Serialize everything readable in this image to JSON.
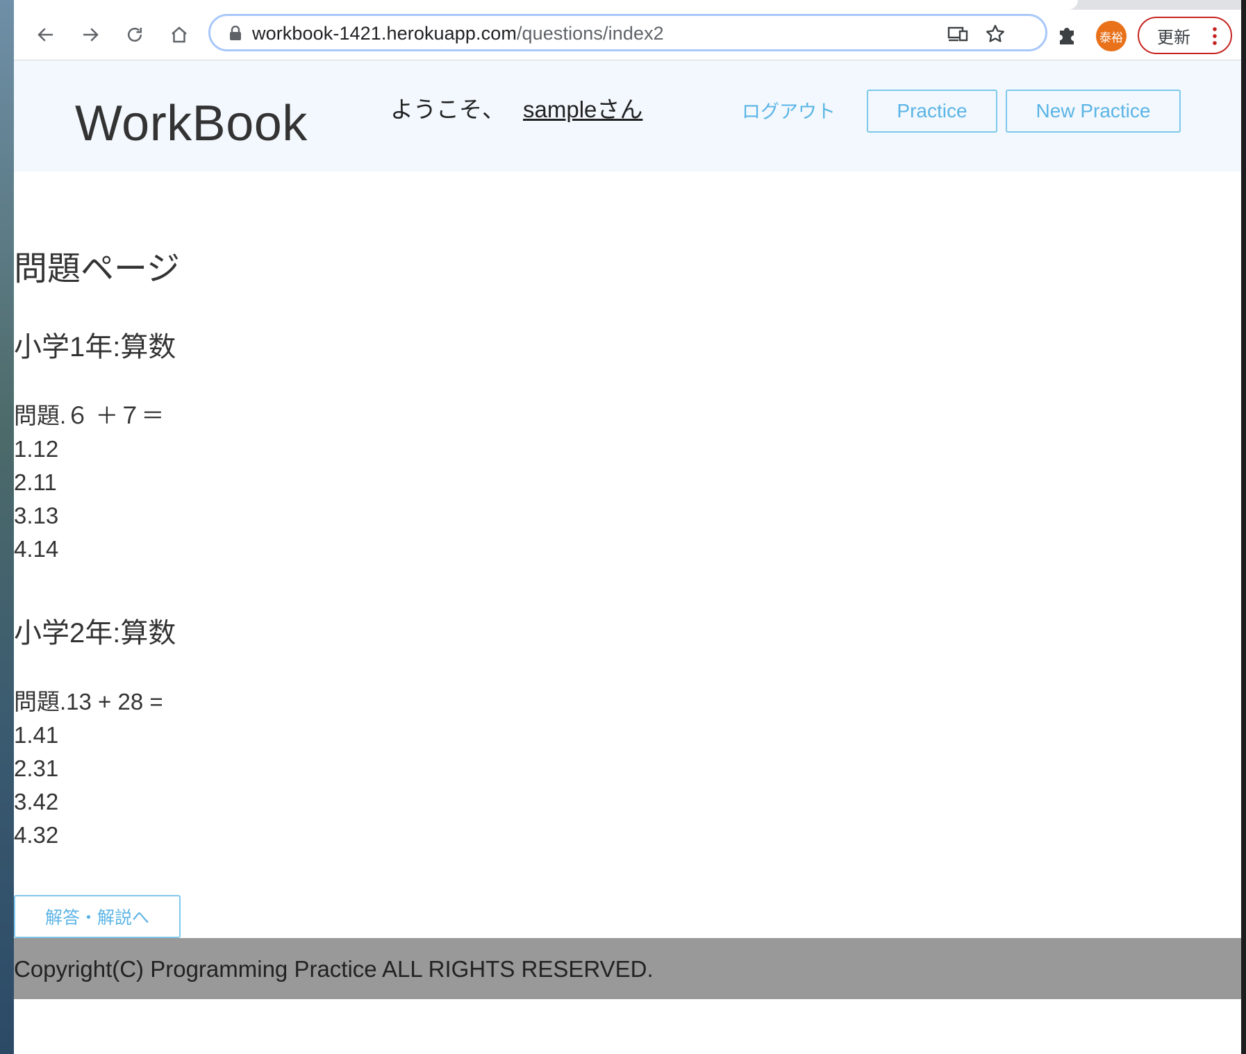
{
  "browser": {
    "url_host": "workbook-1421.herokuapp.com",
    "url_path": "/questions/index2",
    "profile_initials": "泰裕",
    "update_label": "更新"
  },
  "header": {
    "logo": "WorkBook",
    "welcome_prefix": "ようこそ、",
    "username": "sampleさん",
    "logout": "ログアウト",
    "practice_button": "Practice",
    "new_practice_button": "New Practice"
  },
  "main": {
    "page_title": "問題ページ",
    "sections": [
      {
        "title": "小学1年:算数",
        "question": "問題.６ ＋７＝",
        "choices": [
          "1.12",
          "2.11",
          "3.13",
          "4.14"
        ]
      },
      {
        "title": "小学2年:算数",
        "question": "問題.13 + 28 =",
        "choices": [
          "1.41",
          "2.31",
          "3.42",
          "4.32"
        ]
      }
    ],
    "answer_button": "解答・解説へ"
  },
  "footer": {
    "copyright": "Copyright(C) Programming Practice ALL RIGHTS RESERVED."
  },
  "colors": {
    "header_bg": "#f2f8fe",
    "link_blue": "#5bb4e5",
    "footer_bg": "#999999",
    "avatar": "#e8711a"
  }
}
